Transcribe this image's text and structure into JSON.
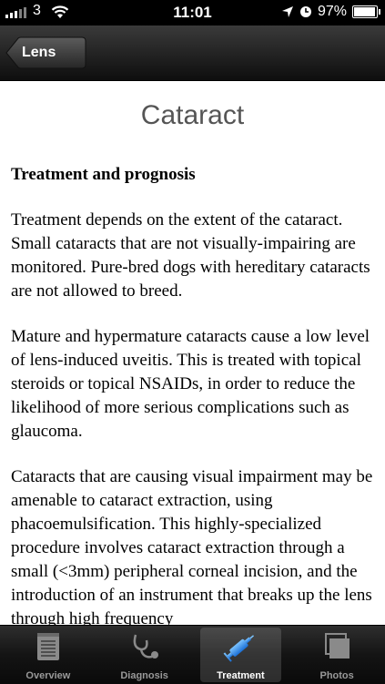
{
  "status_bar": {
    "carrier": "3",
    "time": "11:01",
    "battery": "97%"
  },
  "nav": {
    "back_label": "Lens"
  },
  "page_title": "Cataract",
  "article": {
    "heading": "Treatment and prognosis",
    "paragraphs": [
      "Treatment depends on the extent of the cataract. Small cataracts that are not visually-impairing are monitored. Pure-bred dogs with hereditary cataracts are not allowed to breed.",
      "Mature and hypermature cataracts cause a low level of lens-induced uveitis. This is treated with topical steroids or topical NSAIDs, in order to reduce the likelihood of more serious complications such as glaucoma.",
      "Cataracts that are causing visual impairment may be amenable to cataract extraction, using phacoemulsification. This highly-specialized procedure involves cataract extraction through a small (<3mm) peripheral corneal incision, and the introduction of an instrument that breaks up the lens through high frequency"
    ]
  },
  "tabs": [
    {
      "label": "Overview",
      "icon": "notepad-icon"
    },
    {
      "label": "Diagnosis",
      "icon": "stethoscope-icon"
    },
    {
      "label": "Treatment",
      "icon": "syringe-icon"
    },
    {
      "label": "Photos",
      "icon": "photos-icon"
    }
  ],
  "active_tab": "Treatment"
}
